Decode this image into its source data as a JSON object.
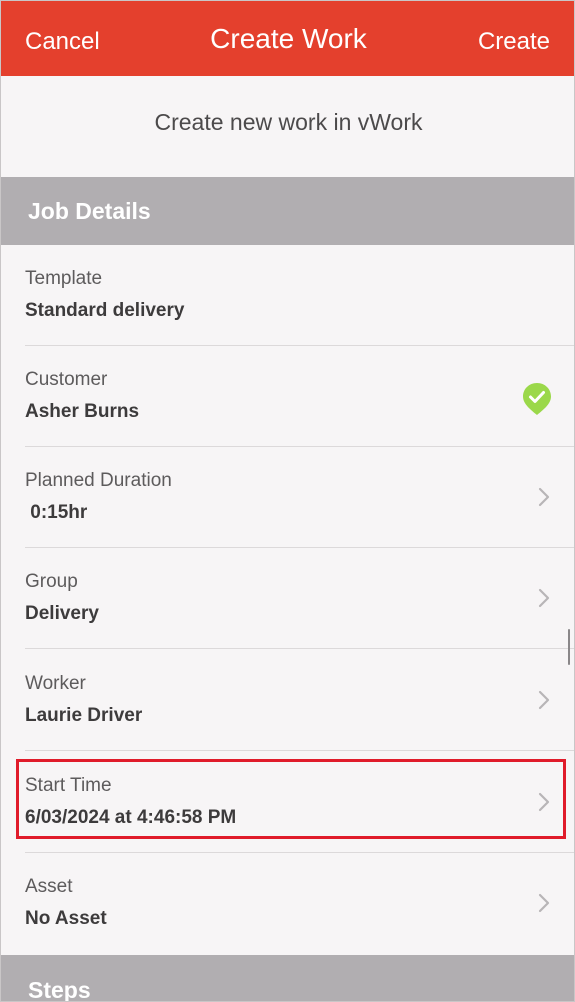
{
  "navbar": {
    "cancel_label": "Cancel",
    "title": "Create Work",
    "create_label": "Create",
    "background_color": "#e4402d"
  },
  "subtitle": "Create new work in vWork",
  "sections": {
    "job_details": "Job Details",
    "steps": "Steps"
  },
  "rows": [
    {
      "label": "Template",
      "value": "Standard delivery",
      "accessory": "none"
    },
    {
      "label": "Customer",
      "value": "Asher Burns",
      "accessory": "check-icon"
    },
    {
      "label": "Planned Duration",
      "value": " 0:15hr",
      "accessory": "chevron-right-icon"
    },
    {
      "label": "Group",
      "value": "Delivery",
      "accessory": "chevron-right-icon"
    },
    {
      "label": "Worker",
      "value": "Laurie Driver",
      "accessory": "chevron-right-icon"
    },
    {
      "label": "Start Time",
      "value": "6/03/2024 at 4:46:58 PM",
      "accessory": "chevron-right-icon"
    },
    {
      "label": "Asset",
      "value": "No Asset",
      "accessory": "chevron-right-icon"
    }
  ],
  "colors": {
    "accent": "#e4402d",
    "section_header": "#b1aeb1",
    "check_green": "#9bd84a",
    "highlight": "#e01b2a"
  }
}
